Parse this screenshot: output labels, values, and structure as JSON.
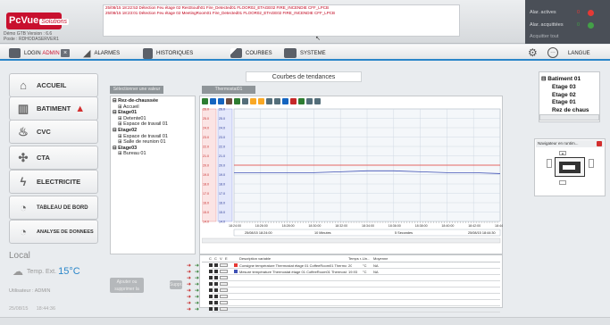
{
  "app": {
    "logo_text": "PcVue",
    "logo_suffix": "Solutions",
    "demo_line1": "Démo GTB      Version : 6.6",
    "demo_line2": "Poste : RDHODASERVER1"
  },
  "alarm_strip": {
    "rows": [
      "25/08/15 18:22:53  Détection Feu étage 02 RestSouth01 Fire_Detected01  FLOOR02_ETAGE02  FIRE_INCENDIE  CFF_LPCB",
      "25/08/15 18:23:01  Détection Feu étage 02 MeetingRoom01 Fire_Detected01  FLOOR02_ETAGE02  FIRE_INCENDIE  CFF_LPCB"
    ]
  },
  "alarm_panel": {
    "active_label": "Alar. actives",
    "active_count": "0",
    "acked_label": "Alar. acquittées",
    "acked_count": "0",
    "ack_all": "Acquitter tout",
    "active_color": "#e53935",
    "acked_color": "#43a047"
  },
  "nav": {
    "login_label": "LOGIN",
    "login_user": "ADMIN",
    "alarms": "ALARMES",
    "historiques": "HISTORIQUES",
    "courbes": "COURBES",
    "systeme": "SYSTEME",
    "langue": "LANGUE"
  },
  "menu": [
    {
      "label": "ACCUEIL",
      "icon": "home-icon"
    },
    {
      "label": "BATIMENT",
      "icon": "building-icon"
    },
    {
      "label": "CVC",
      "icon": "hvac-icon"
    },
    {
      "label": "CTA",
      "icon": "fan-icon"
    },
    {
      "label": "ELECTRICITE",
      "icon": "lightning-icon"
    },
    {
      "label": "TABLEAU DE BORD",
      "icon": "gauge-icon"
    },
    {
      "label": "ANALYSE DE DONNEES",
      "icon": "gauge-icon"
    }
  ],
  "local": {
    "title": "Local",
    "temp_label": "Temp. Ext.",
    "temp_value": "15°C",
    "user": "Utilisateur : ADMIN",
    "date": "25/08/15",
    "time": "18:44:36"
  },
  "main": {
    "title": "Courbes de tendances",
    "tab1": "Sélectionner une valeur",
    "tab2": "Thermostat01",
    "remove_curve": "Ajouter ou supprimer la courbe",
    "delete_btn": "Suppr."
  },
  "tree": [
    {
      "label": "Rez-de-chaussée",
      "level": 0
    },
    {
      "label": "Accueil",
      "level": 1
    },
    {
      "label": "Etage01",
      "level": 0
    },
    {
      "label": "Detente01",
      "level": 1
    },
    {
      "label": "Espace de travail 01",
      "level": 1
    },
    {
      "label": "Etage02",
      "level": 0
    },
    {
      "label": "Espace de travail 01",
      "level": 1
    },
    {
      "label": "Salle de reunion 01",
      "level": 1
    },
    {
      "label": "Etage03",
      "level": 0
    },
    {
      "label": "Bureau 01",
      "level": 1
    }
  ],
  "chart_data": {
    "type": "line",
    "x": [
      "18:24:00",
      "18:26:00",
      "18:28:00",
      "18:30:00",
      "18:32:00",
      "18:34:00",
      "18:36:00",
      "18:38:00",
      "18:40:00",
      "18:42:00",
      "18:44:00"
    ],
    "series": [
      {
        "values": [
          20.0,
          20.0,
          20.0,
          20.0,
          20.0,
          20.0,
          20.0,
          20.0,
          20.0,
          20.0,
          20.0
        ],
        "color": "#e53935"
      },
      {
        "values": [
          19.2,
          19.2,
          19.2,
          19.2,
          19.3,
          19.4,
          19.4,
          19.3,
          19.2,
          19.2,
          19.1
        ],
        "color": "#3f51b5"
      }
    ],
    "ylim": [
      14,
      26
    ],
    "date_labels": [
      "25/08/15 18:24:00",
      "10 Minutes",
      "5 Secondes",
      "25/08/15 18:44:30"
    ],
    "grid": true
  },
  "grid_table": {
    "headers": [
      "C",
      "C",
      "V",
      "E",
      "Description variable",
      "Temps r...",
      "Un...",
      "Moyenne"
    ],
    "rows": [
      {
        "desc": "Consigne température Thermostat étage 01 CoffeeRoom01 Thermostat01",
        "value": "20",
        "unit": "°C",
        "avg": "NA",
        "color": "#e53935"
      },
      {
        "desc": "Mesure température Thermostat étage 01 CoffeeRoom01 Thermostat01",
        "value": "19.93",
        "unit": "°C",
        "avg": "NA",
        "color": "#3f51b5"
      }
    ]
  },
  "right_tree": {
    "root": "Batiment 01",
    "items": [
      "Etage 03",
      "Etage 02",
      "Etage 01",
      "Rez de chaus"
    ]
  },
  "navigator": {
    "title": "Navigateur en runtim..."
  }
}
